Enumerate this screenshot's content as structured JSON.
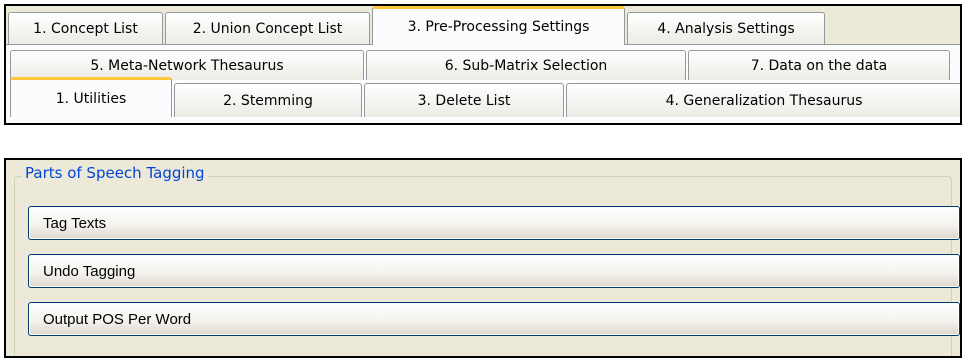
{
  "main_tabs": [
    "1. Concept List",
    "2. Union Concept List",
    "3. Pre-Processing Settings",
    "4. Analysis Settings"
  ],
  "sub_tabs_back": [
    "5. Meta-Network Thesaurus",
    "6. Sub-Matrix Selection",
    "7. Data on the data"
  ],
  "sub_tabs_front": [
    "1. Utilities",
    "2. Stemming",
    "3. Delete List",
    "4. Generalization Thesaurus"
  ],
  "group": {
    "legend": "Parts of Speech Tagging",
    "buttons": [
      "Tag Texts",
      "Undo Tagging",
      "Output POS Per Word"
    ]
  },
  "colors": {
    "selected_tab_accent": "#ffc83c",
    "group_legend": "#0046d5",
    "button_border": "#003c74",
    "panel_background": "#ece9d8"
  }
}
